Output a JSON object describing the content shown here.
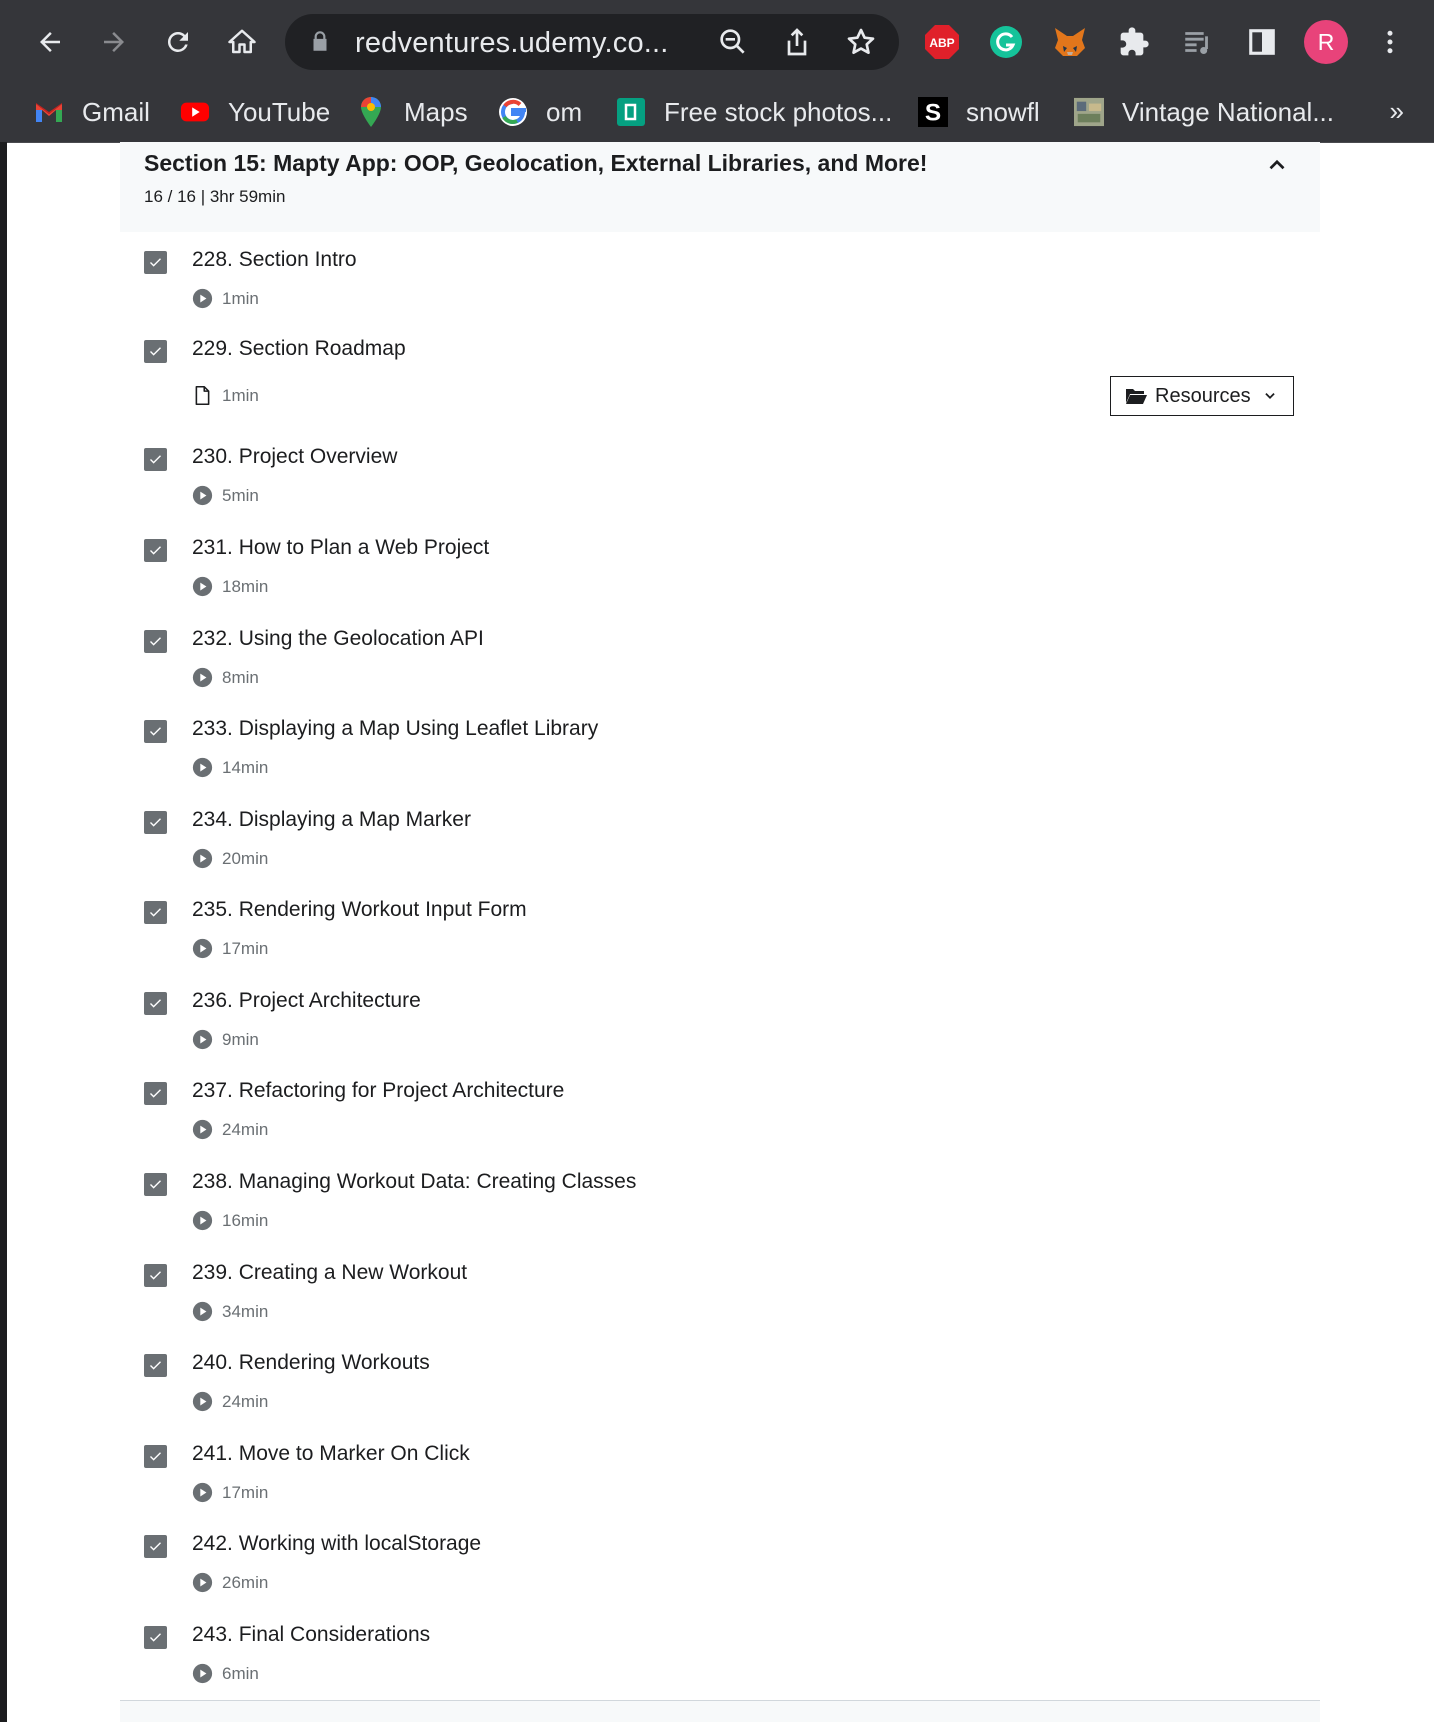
{
  "browser": {
    "url": "redventures.udemy.co...",
    "profile_initial": "R",
    "abp_label": "ABP",
    "bookmarks": [
      {
        "label": "Gmail",
        "icon": "gmail-icon"
      },
      {
        "label": "YouTube",
        "icon": "youtube-icon"
      },
      {
        "label": "Maps",
        "icon": "maps-icon"
      },
      {
        "label": "om",
        "icon": "google-icon"
      },
      {
        "label": "Free stock photos...",
        "icon": "stock-photos-icon"
      },
      {
        "label": "snowfl",
        "icon": "snowfl-icon"
      },
      {
        "label": "Vintage National...",
        "icon": "vintage-national-icon"
      }
    ],
    "more_bookmarks": "»"
  },
  "section": {
    "title": "Section 15: Mapty App: OOP, Geolocation, External Libraries, and More!",
    "meta": "16 / 16 | 3hr 59min"
  },
  "lectures": [
    {
      "title": "228. Section Intro",
      "duration": "1min",
      "type": "video"
    },
    {
      "title": "229. Section Roadmap",
      "duration": "1min",
      "type": "article"
    },
    {
      "title": "230. Project Overview",
      "duration": "5min",
      "type": "video"
    },
    {
      "title": "231. How to Plan a Web Project",
      "duration": "18min",
      "type": "video"
    },
    {
      "title": "232. Using the Geolocation API",
      "duration": "8min",
      "type": "video"
    },
    {
      "title": "233. Displaying a Map Using Leaflet Library",
      "duration": "14min",
      "type": "video"
    },
    {
      "title": "234. Displaying a Map Marker",
      "duration": "20min",
      "type": "video"
    },
    {
      "title": "235. Rendering Workout Input Form",
      "duration": "17min",
      "type": "video"
    },
    {
      "title": "236. Project Architecture",
      "duration": "9min",
      "type": "video"
    },
    {
      "title": "237. Refactoring for Project Architecture",
      "duration": "24min",
      "type": "video"
    },
    {
      "title": "238. Managing Workout Data: Creating Classes",
      "duration": "16min",
      "type": "video"
    },
    {
      "title": "239. Creating a New Workout",
      "duration": "34min",
      "type": "video"
    },
    {
      "title": "240. Rendering Workouts",
      "duration": "24min",
      "type": "video"
    },
    {
      "title": "241. Move to Marker On Click",
      "duration": "17min",
      "type": "video"
    },
    {
      "title": "242. Working with localStorage",
      "duration": "26min",
      "type": "video"
    },
    {
      "title": "243. Final Considerations",
      "duration": "6min",
      "type": "video"
    }
  ],
  "resources_button": {
    "label": "Resources"
  },
  "colors": {
    "chrome_bg": "#35363a",
    "omnibox_bg": "#202124",
    "checkbox": "#6a6f73",
    "header_bg": "#f7f9fa",
    "profile": "#e8437a",
    "abp": "#e0202a",
    "grammarly": "#15c39a"
  }
}
